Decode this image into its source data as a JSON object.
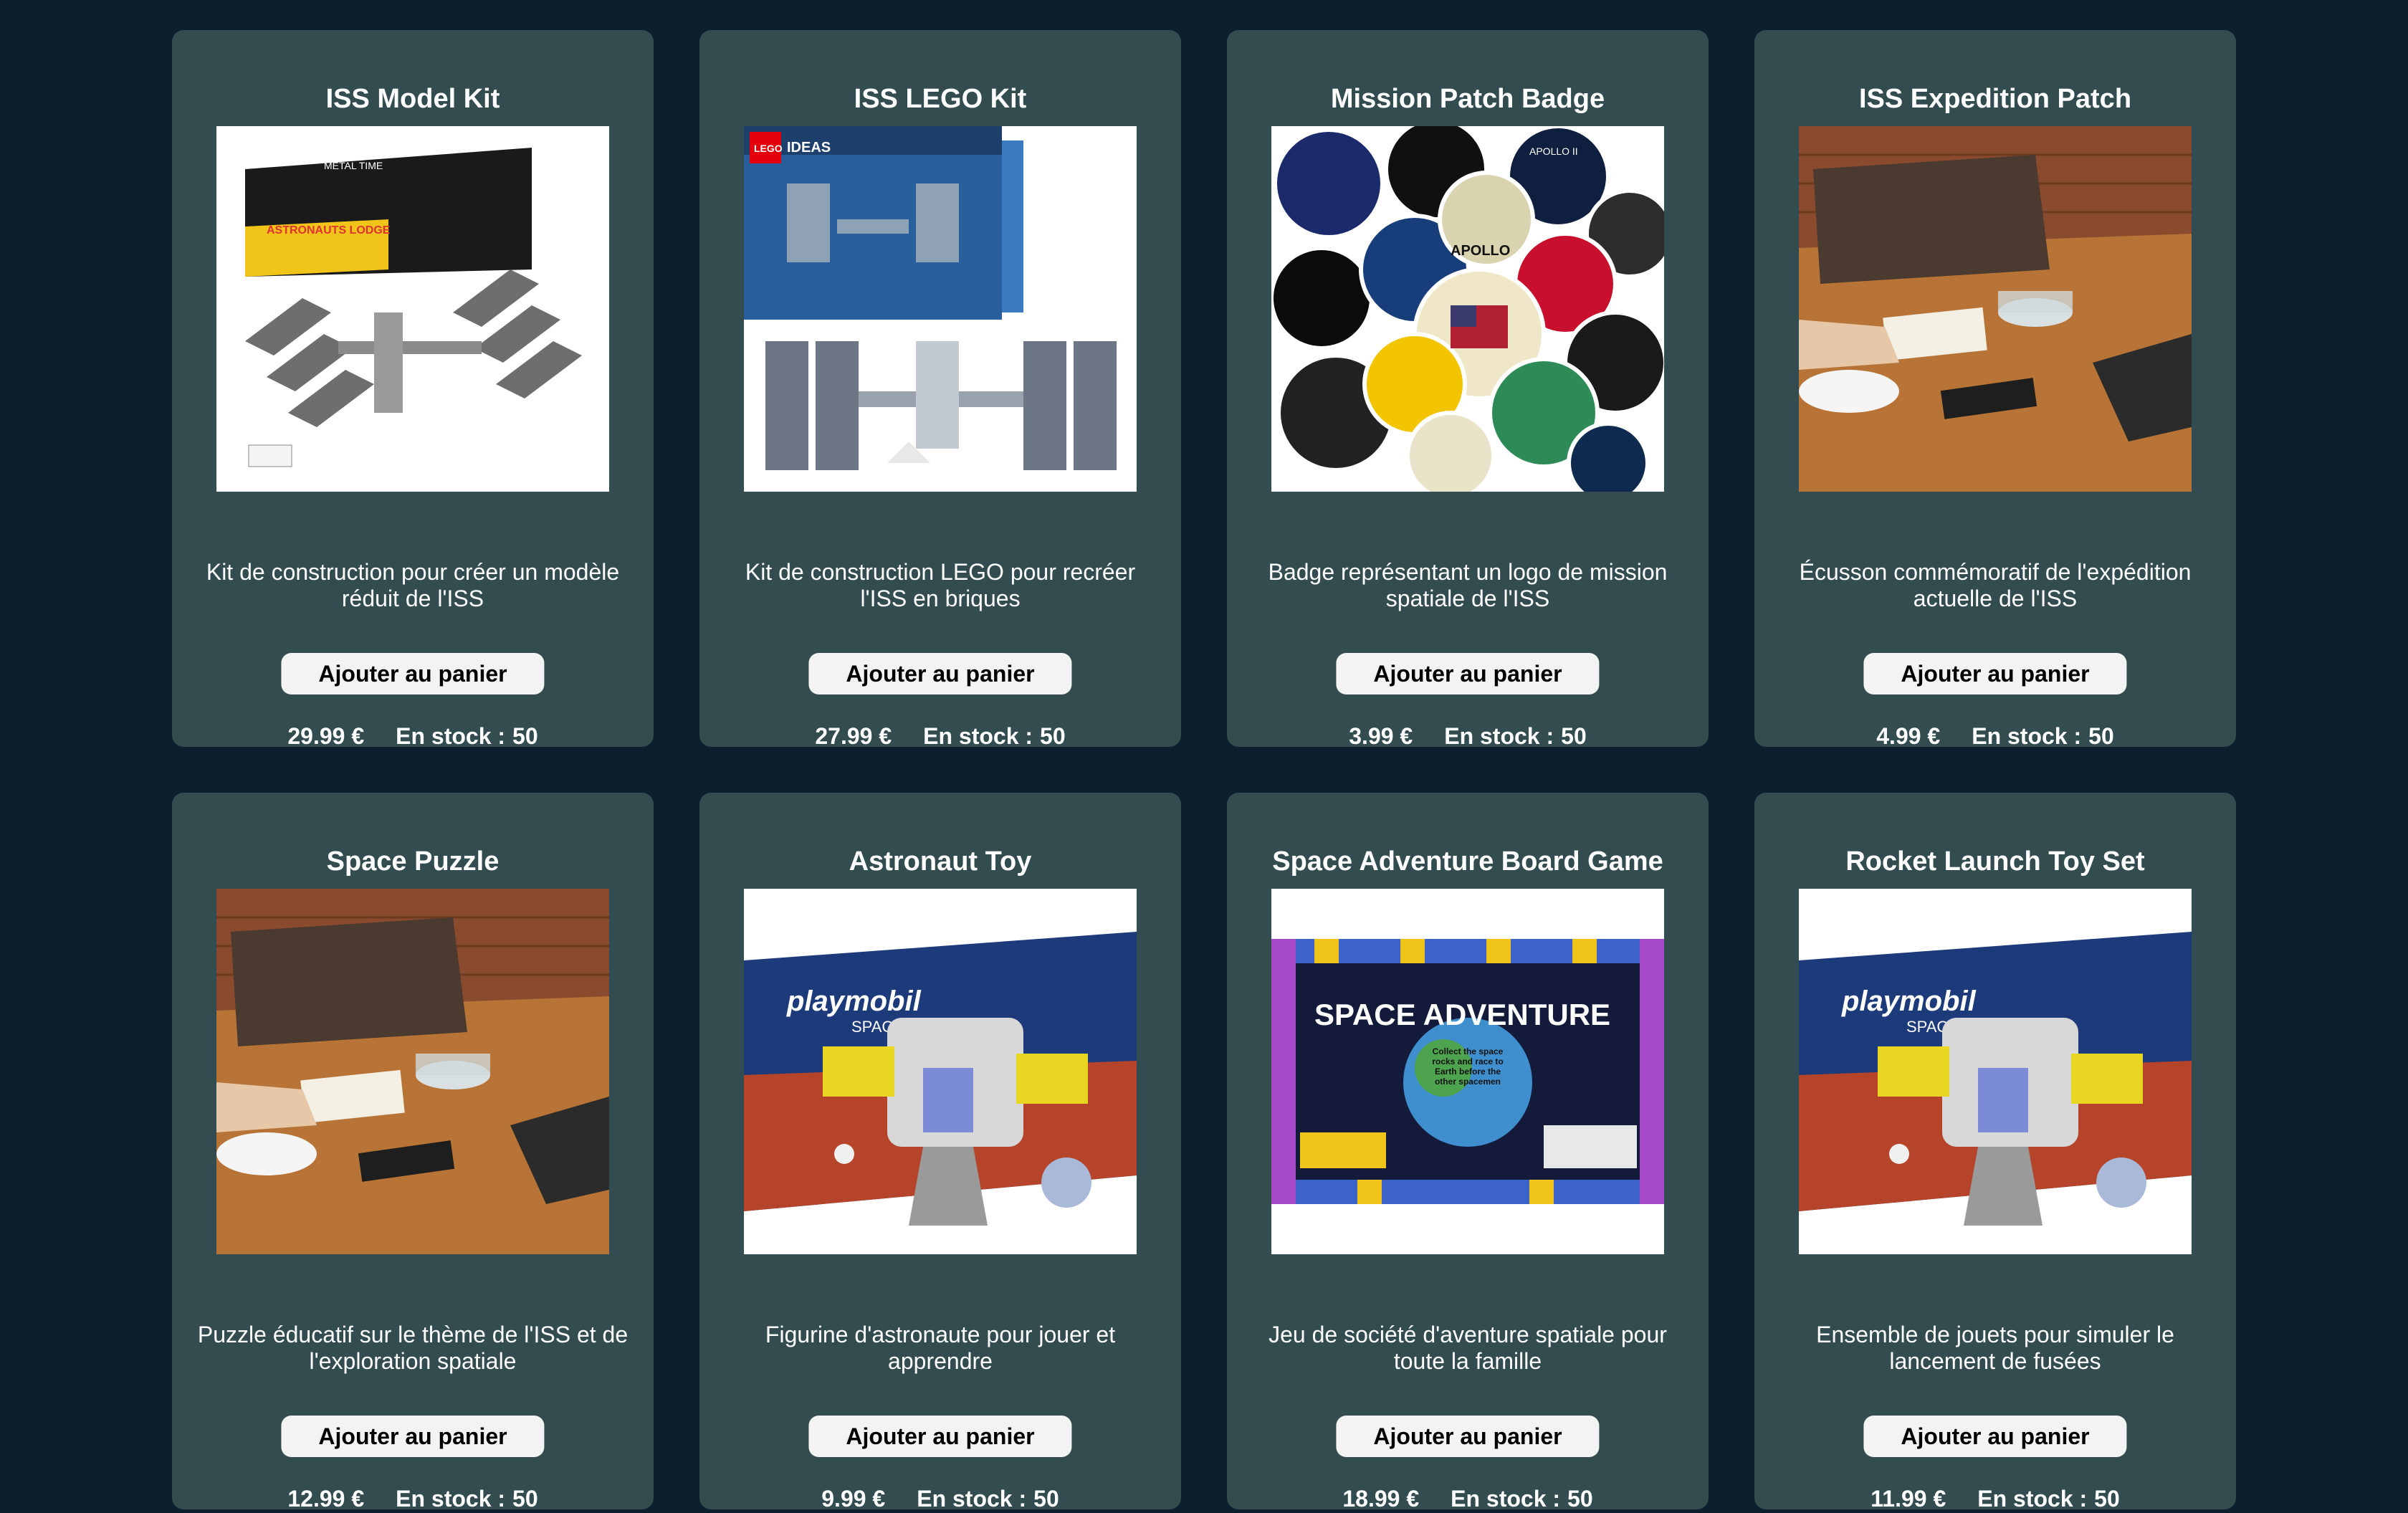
{
  "products": [
    {
      "title": "ISS Model Kit",
      "image": "iss-model-kit-box-image",
      "description": "Kit de construction pour créer un modèle réduit de l'ISS",
      "button": "Ajouter au panier",
      "price": "29.99 €",
      "stock_label": "En stock :",
      "stock_value": "50",
      "box_brand": "METAL TIME",
      "box_text": "ASTRONAUTS LODGE"
    },
    {
      "title": "ISS LEGO Kit",
      "image": "iss-lego-kit-box-image",
      "description": "Kit de construction LEGO pour recréer l'ISS en briques",
      "button": "Ajouter au panier",
      "price": "27.99 €",
      "stock_label": "En stock :",
      "stock_value": "50",
      "box_brand": "LEGO",
      "box_text": "IDEAS"
    },
    {
      "title": "Mission Patch Badge",
      "image": "mission-patches-image",
      "description": "Badge représentant un logo de mission spatiale de l'ISS",
      "button": "Ajouter au panier",
      "price": "3.99 €",
      "stock_label": "En stock :",
      "stock_value": "50",
      "box_brand": "APOLLO",
      "box_text": "APOLLO II"
    },
    {
      "title": "ISS Expedition Patch",
      "image": "table-desk-photo",
      "description": "Écusson commémoratif de l'expédition actuelle de l'ISS",
      "button": "Ajouter au panier",
      "price": "4.99 €",
      "stock_label": "En stock :",
      "stock_value": "50",
      "box_brand": "",
      "box_text": ""
    },
    {
      "title": "Space Puzzle",
      "image": "table-desk-photo",
      "description": "Puzzle éducatif sur le thème de l'ISS et de l'exploration spatiale",
      "button": "Ajouter au panier",
      "price": "12.99 €",
      "stock_label": "En stock :",
      "stock_value": "50",
      "box_brand": "",
      "box_text": ""
    },
    {
      "title": "Astronaut Toy",
      "image": "playmobil-space-box-image",
      "description": "Figurine d'astronaute pour jouer et apprendre",
      "button": "Ajouter au panier",
      "price": "9.99 €",
      "stock_label": "En stock :",
      "stock_value": "50",
      "box_brand": "playmobil",
      "box_text": "SPACE"
    },
    {
      "title": "Space Adventure Board Game",
      "image": "space-adventure-board-image",
      "description": "Jeu de société d'aventure spatiale pour toute la famille",
      "button": "Ajouter au panier",
      "price": "18.99 €",
      "stock_label": "En stock :",
      "stock_value": "50",
      "box_brand": "SPACE ADVENTURE",
      "box_text": "Collect the space rocks and race to Earth before the other spacemen"
    },
    {
      "title": "Rocket Launch Toy Set",
      "image": "playmobil-space-box-image",
      "description": "Ensemble de jouets pour simuler le lancement de fusées",
      "button": "Ajouter au panier",
      "price": "11.99 €",
      "stock_label": "En stock :",
      "stock_value": "50",
      "box_brand": "playmobil",
      "box_text": "SPACE"
    }
  ]
}
